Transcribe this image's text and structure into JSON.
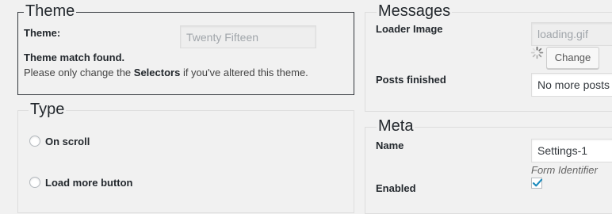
{
  "theme": {
    "legend": "Theme",
    "theme_label": "Theme:",
    "theme_value": "Twenty Fifteen",
    "match_found": "Theme match found.",
    "note_prefix": "Please only change the ",
    "note_bold": "Selectors",
    "note_suffix": " if you've altered this theme."
  },
  "type": {
    "legend": "Type",
    "options": [
      "On scroll",
      "Load more button"
    ]
  },
  "messages": {
    "legend": "Messages",
    "loader_label": "Loader Image",
    "loader_value": "loading.gif",
    "change_button": "Change",
    "posts_finished_label": "Posts finished",
    "posts_finished_value": "No more posts"
  },
  "meta": {
    "legend": "Meta",
    "name_label": "Name",
    "name_value": "Settings-1",
    "name_hint": "Form Identifier",
    "enabled_label": "Enabled",
    "enabled_checked": true
  },
  "colors": {
    "checkmark": "#1e8cbe",
    "fieldset_border": "#dddddd",
    "theme_border": "#32373c"
  }
}
